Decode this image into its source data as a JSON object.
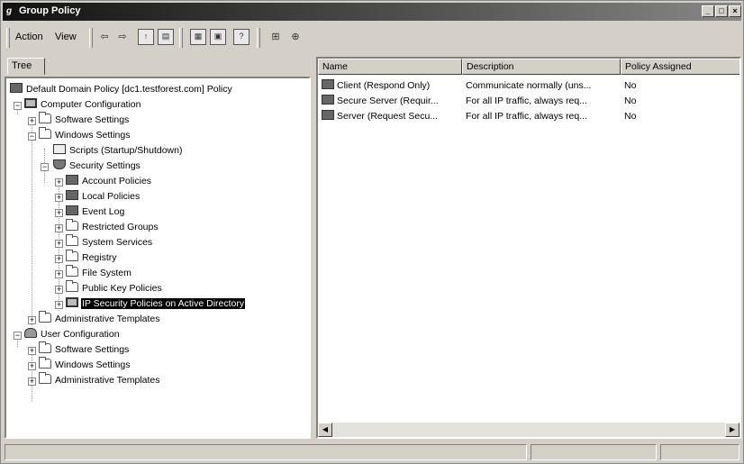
{
  "window": {
    "title": "Group Policy",
    "app_icon": "gpedit-icon"
  },
  "menu": {
    "action_label": "Action",
    "view_label": "View"
  },
  "toolbar": {
    "back_glyph": "⇦",
    "forward_glyph": "⇨"
  },
  "tree_tab": "Tree",
  "tree": {
    "root": "Default Domain Policy [dc1.testforest.com] Policy",
    "computer_config": "Computer Configuration",
    "cc_software": "Software Settings",
    "cc_windows": "Windows Settings",
    "scripts": "Scripts (Startup/Shutdown)",
    "security": "Security Settings",
    "account": "Account Policies",
    "local": "Local Policies",
    "eventlog": "Event Log",
    "restricted": "Restricted Groups",
    "services": "System Services",
    "registry": "Registry",
    "filesystem": "File System",
    "publickey": "Public Key Policies",
    "ipsec": "IP Security Policies on Active Directory",
    "cc_admin": "Administrative Templates",
    "user_config": "User Configuration",
    "uc_software": "Software Settings",
    "uc_windows": "Windows Settings",
    "uc_admin": "Administrative Templates"
  },
  "list": {
    "columns": [
      "Name",
      "Description",
      "Policy Assigned"
    ],
    "rows": [
      {
        "name": "Client (Respond Only)",
        "description": "Communicate normally (uns...",
        "assigned": "No"
      },
      {
        "name": "Secure Server (Requir...",
        "description": "For all IP traffic, always req...",
        "assigned": "No"
      },
      {
        "name": "Server (Request Secu...",
        "description": "For all IP traffic, always req...",
        "assigned": "No"
      }
    ]
  },
  "colors": {
    "title_bar": "#111111",
    "selection": "#000000",
    "face": "#d4d0c8"
  }
}
